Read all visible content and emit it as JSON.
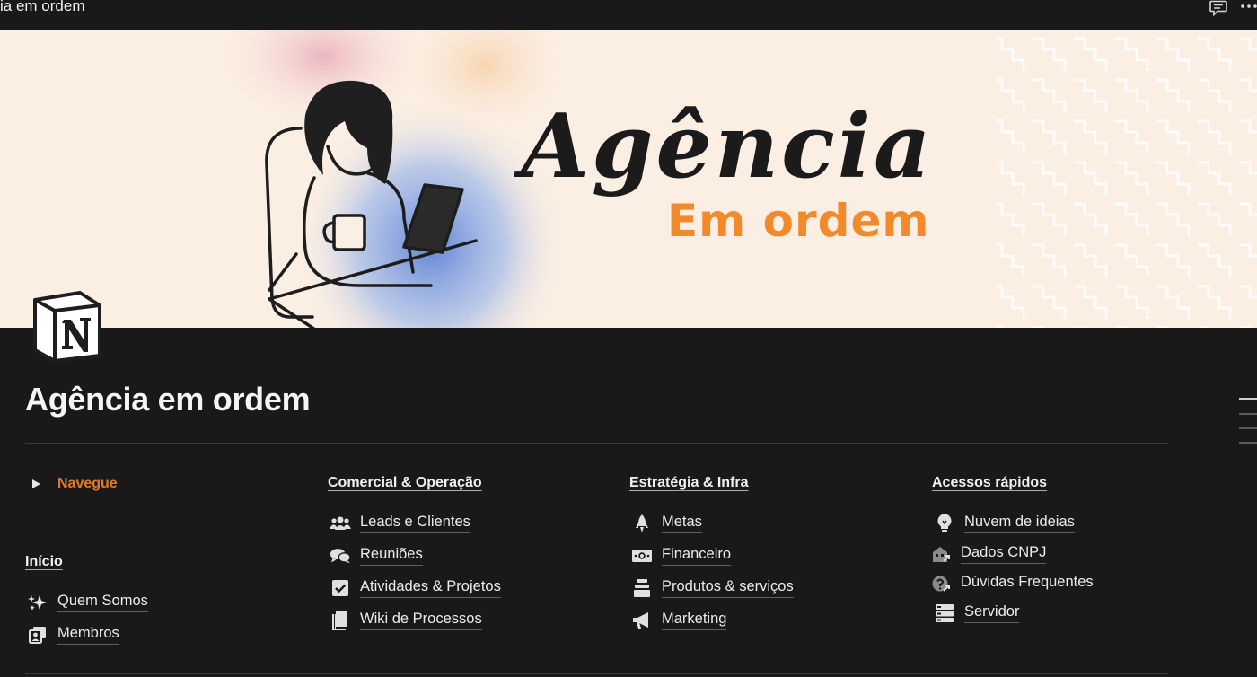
{
  "topbar": {
    "title": "ia em ordem"
  },
  "cover": {
    "headline": "Agência",
    "subline": "Em ordem",
    "colors": {
      "background": "#fbeee3",
      "subline": "#f28a2c",
      "headline": "#1b1b1b"
    }
  },
  "page": {
    "title": "Agência em ordem"
  },
  "toggle": {
    "label": "Navegue",
    "color": "#e07b2a"
  },
  "inicio": {
    "heading": "Início",
    "items": [
      {
        "label": "Quem Somos",
        "icon": "sparkles-icon"
      },
      {
        "label": "Membros",
        "icon": "members-icon"
      }
    ]
  },
  "comercial": {
    "heading": "Comercial & Operação",
    "items": [
      {
        "label": "Leads e Clientes",
        "icon": "people-icon"
      },
      {
        "label": "Reuniões",
        "icon": "chat-bubbles-icon"
      },
      {
        "label": "Atividades & Projetos",
        "icon": "checkbox-icon"
      },
      {
        "label": "Wiki de Processos",
        "icon": "book-icon"
      }
    ]
  },
  "estrategia": {
    "heading": "Estratégia & Infra",
    "items": [
      {
        "label": "Metas",
        "icon": "rocket-icon"
      },
      {
        "label": "Financeiro",
        "icon": "money-icon"
      },
      {
        "label": "Produtos & serviços",
        "icon": "stack-icon"
      },
      {
        "label": "Marketing",
        "icon": "megaphone-icon"
      }
    ]
  },
  "acessos": {
    "heading": "Acessos rápidos",
    "items": [
      {
        "label": "Nuvem de ideias",
        "icon": "lightbulb-icon"
      },
      {
        "label": "Dados CNPJ",
        "icon": "building-link-icon"
      },
      {
        "label": "Dúvidas Frequentes",
        "icon": "question-link-icon"
      },
      {
        "label": "Servidor",
        "icon": "server-icon"
      }
    ]
  }
}
